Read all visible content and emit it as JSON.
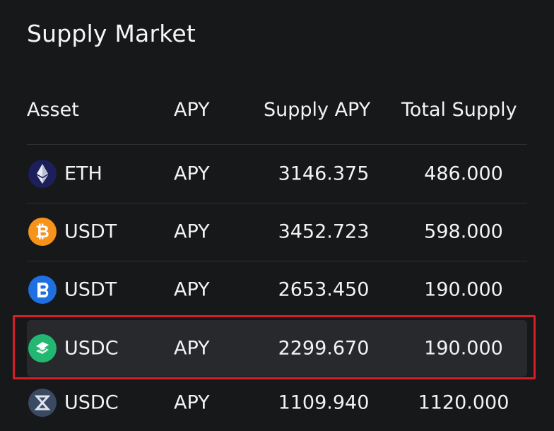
{
  "title": "Supply Market",
  "columns": {
    "asset": "Asset",
    "apy": "APY",
    "supply_apy": "Supply APY",
    "total_supply": "Total Supply"
  },
  "rows": [
    {
      "name": "ETH",
      "apy": "APY",
      "supply_apy": "3146.375",
      "total_supply": "486.000",
      "icon": "ethereum-icon"
    },
    {
      "name": "USDT",
      "apy": "APY",
      "supply_apy": "3452.723",
      "total_supply": "598.000",
      "icon": "bitcoin-icon"
    },
    {
      "name": "USDT",
      "apy": "APY",
      "supply_apy": "2653.450",
      "total_supply": "190.000",
      "icon": "blue-b-token-icon"
    },
    {
      "name": "USDC",
      "apy": "APY",
      "supply_apy": "2299.670",
      "total_supply": "190.000",
      "icon": "green-layers-token-icon",
      "selected": true
    },
    {
      "name": "USDC",
      "apy": "APY",
      "supply_apy": "1109.940",
      "total_supply": "1120.000",
      "icon": "slash-token-icon"
    }
  ],
  "colors": {
    "background": "#17181a",
    "selected_row": "#27292c",
    "highlight_border": "#d61e28",
    "eth": "#1c1f5a",
    "btc": "#f7931a",
    "blue_token": "#1e6fe0",
    "green_token": "#22b872",
    "slate_token": "#3a4a63"
  }
}
